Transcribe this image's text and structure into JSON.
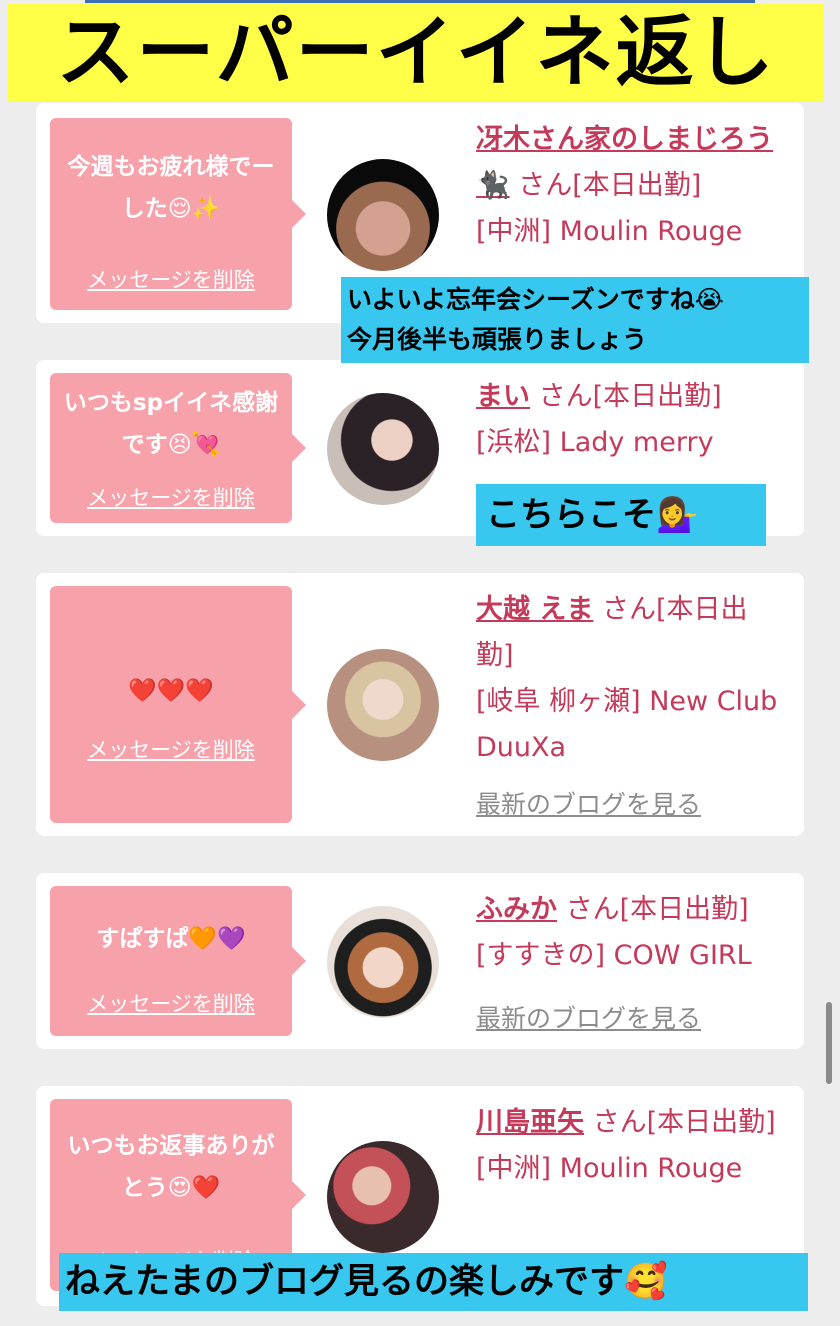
{
  "title_banner": "スーパーイイネ返し",
  "delete_label": "メッセージを削除",
  "blog_label": "最新のブログを見る",
  "colors": {
    "banner_bg": "#ffff47",
    "bubble_bg": "#f7a1ab",
    "link_pink": "#c43a5a",
    "overlay_cyan": "#38c8ef"
  },
  "cards": [
    {
      "message": "今週もお疲れ様でーした😌✨",
      "name": "冴木さん家のしまじろう🐈‍⬛",
      "suffix": "さん[本日出勤]",
      "shop": "[中洲] Moulin Rouge"
    },
    {
      "message": "いつもspイイネ感謝です😣💘",
      "name": "まい",
      "suffix": "さん[本日出勤]",
      "shop": "[浜松] Lady merry"
    },
    {
      "message": "❤️❤️❤️",
      "name": "大越 えま",
      "suffix": "さん[本日出勤]",
      "shop": "[岐阜 柳ヶ瀬] New Club DuuXa"
    },
    {
      "message": "すぱすぱ🧡💜",
      "name": "ふみか",
      "suffix": "さん[本日出勤]",
      "shop": "[すすきの] COW GIRL"
    },
    {
      "message": "いつもお返事ありがとう😍❤️",
      "name": "川島亜矢",
      "suffix": "さん[本日出勤]",
      "shop": "[中洲] Moulin Rouge"
    }
  ],
  "overlays": {
    "reply1_line1": "いよいよ忘年会シーズンですね😭",
    "reply1_line2": "今月後半も頑張りましょう",
    "reply2": "こちらこそ💁‍♀️",
    "reply3": "ねえたまのブログ見るの楽しみです🥰"
  }
}
